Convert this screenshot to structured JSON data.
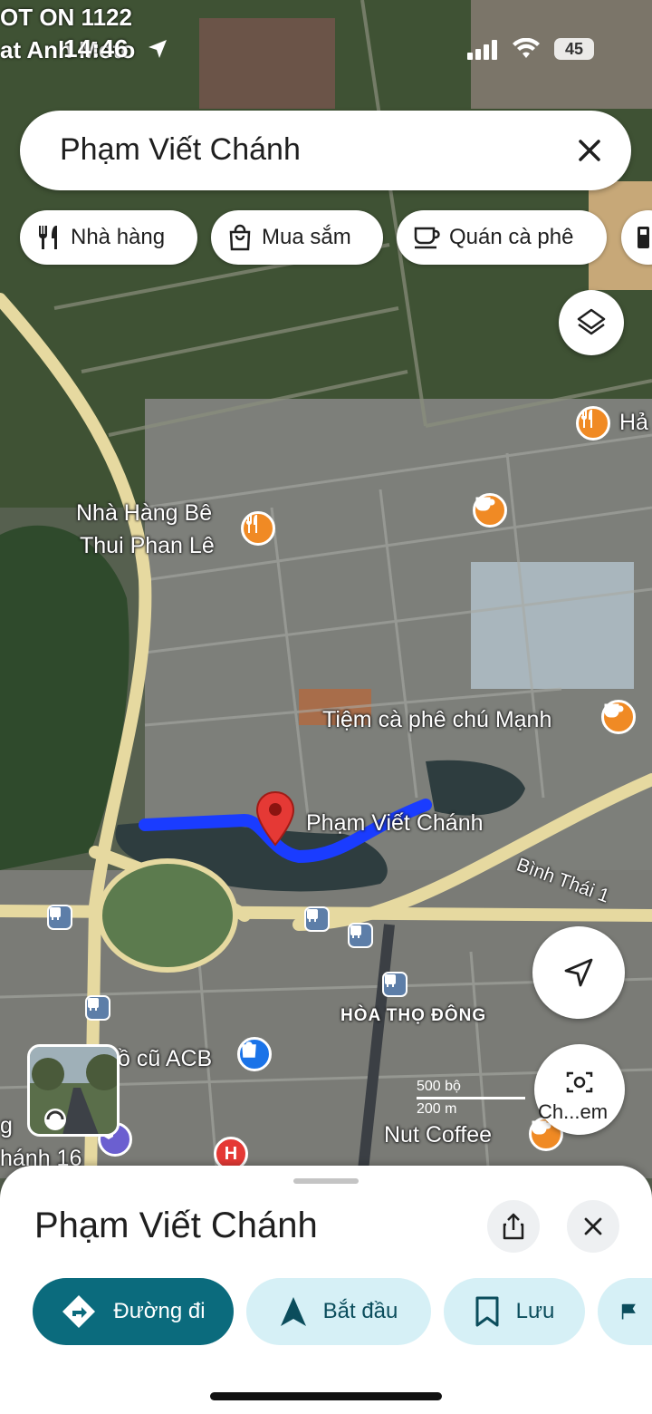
{
  "status_bar": {
    "carrier_line1": "OT ON 1122",
    "carrier_line2": "at Anh Moto",
    "time": "14:46",
    "battery": "45"
  },
  "search": {
    "query": "Phạm Viết Chánh"
  },
  "chips": [
    {
      "label": "Nhà hàng",
      "icon": "fork-knife-icon"
    },
    {
      "label": "Mua sắm",
      "icon": "shopping-bag-icon"
    },
    {
      "label": "Quán cà phê",
      "icon": "coffee-cup-icon"
    }
  ],
  "map": {
    "labels": {
      "restaurant_line1": "Nhà Hàng Bê",
      "restaurant_line2": "Thui Phan Lê",
      "coffee_manh": "Tiệm cà phê chú Mạnh",
      "pin_street": "Phạm Viết Chánh",
      "binh_thai": "Bình Thái 1",
      "hoa_tho_dong": "HÒA THỌ ĐÔNG",
      "acb": "ồ cũ ACB",
      "nut_coffee": "Nut Coffee",
      "edge_top_right": "Hả",
      "edge_left_1": "g",
      "edge_left_2": "hánh 16"
    },
    "scale_label": "500 bộ",
    "scale_sub": "200 m",
    "camera_label": "Ch...em"
  },
  "place_sheet": {
    "title": "Phạm Viết Chánh",
    "actions": [
      {
        "label": "Đường đi",
        "icon": "directions-icon"
      },
      {
        "label": "Bắt đầu",
        "icon": "navigation-arrow-icon"
      },
      {
        "label": "Lưu",
        "icon": "bookmark-icon"
      }
    ]
  },
  "colors": {
    "primary_action": "#0b6b7d",
    "secondary_action": "#d6f0f6",
    "route": "#1a3cff",
    "pin": "#e53935",
    "poi_orange": "#f08a24"
  }
}
